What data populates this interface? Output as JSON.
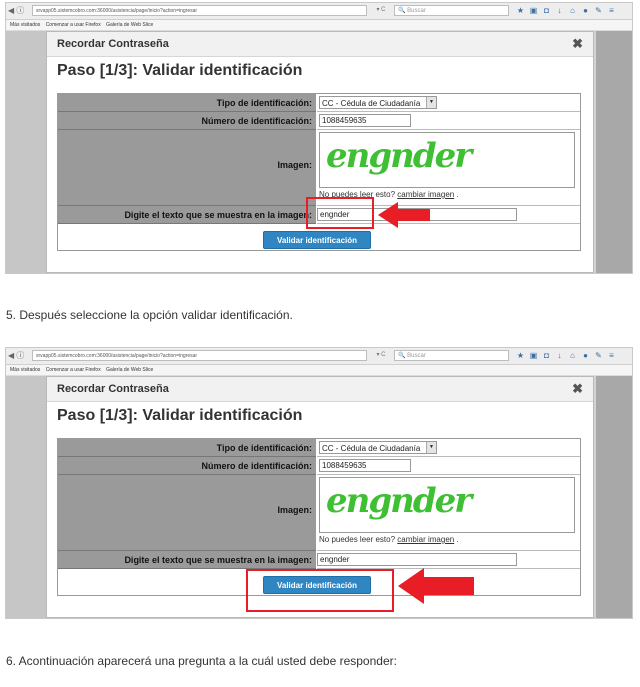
{
  "browser": {
    "url": "srvapp05.sistemcobro.com:36000/asistencia/page/inicio?action=ingresar",
    "search_placeholder": "Buscar",
    "reload_label": "▾ C",
    "bookmarks": [
      "Más visitados",
      "Comenzar a usar Firefox",
      "Galería de Web Slice"
    ]
  },
  "modal": {
    "title": "Recordar Contraseña",
    "close_label": "✖",
    "step_title": "Paso [1/3]: Validar identificación"
  },
  "form": {
    "tipo_label": "Tipo de identificación:",
    "tipo_value": "CC - Cédula de Ciudadanía",
    "numero_label": "Número de identificación:",
    "numero_value": "1088459635",
    "imagen_label": "Imagen:",
    "captcha_text": "engnder",
    "captcha_question": "No puedes leer esto?",
    "captcha_change": "cambiar imagen",
    "captcha_tail": ".",
    "digite_label": "Digite el texto que se muestra en la imagen:",
    "digite_value": "engnder",
    "submit_label": "Validar identificación"
  },
  "captions": {
    "step5": "5. Después seleccione la opción validar identificación.",
    "step6": "6. Acontinuación aparecerá una pregunta a la cuál usted debe responder:"
  },
  "colors": {
    "highlight": "#e81d25",
    "button": "#2f86c3",
    "captcha": "#3fbf34"
  }
}
